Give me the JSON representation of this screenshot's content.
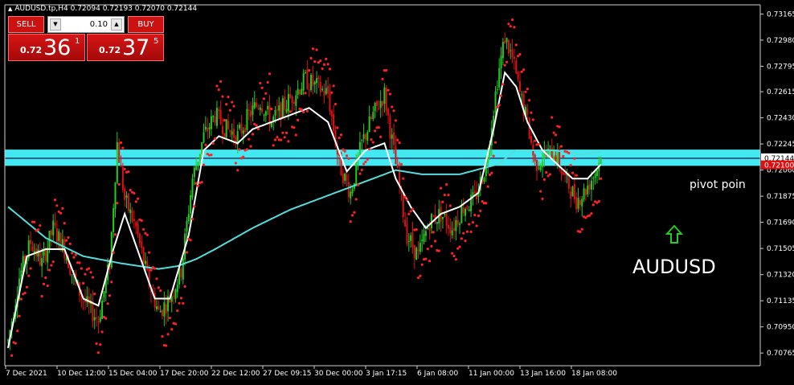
{
  "header": {
    "symbol_line": "AUDUSD.tp,H4  0.72094 0.72193 0.72070 0.72144"
  },
  "trade_panel": {
    "sell_label": "SELL",
    "buy_label": "BUY",
    "lot_value": "0.10",
    "sell_price": {
      "prefix": "0.72",
      "big": "36",
      "sup": "1"
    },
    "buy_price": {
      "prefix": "0.72",
      "big": "37",
      "sup": "5"
    }
  },
  "annotations": {
    "pivot_label": "pivot poin",
    "symbol_label": "AUDUSD"
  },
  "colors": {
    "background": "#000000",
    "bull": "#22cc22",
    "bear": "#dd1111",
    "sar": "#ff2222",
    "ma_fast": "#ffffff",
    "ma_slow": "#55dddd",
    "pivot_zone": "#44e8f0",
    "arrow": "#22cc22"
  },
  "chart_data": {
    "type": "candlestick",
    "symbol": "AUDUSD",
    "timeframe": "H4",
    "ylim": [
      0.70675,
      0.7323
    ],
    "yticks": [
      0.73165,
      0.7298,
      0.72795,
      0.72615,
      0.7243,
      0.72245,
      0.7206,
      0.71875,
      0.7169,
      0.71505,
      0.7132,
      0.71135,
      0.7095,
      0.70765
    ],
    "xticks": [
      "7 Dec 2021",
      "10 Dec 12:00",
      "15 Dec 04:00",
      "17 Dec 20:00",
      "22 Dec 12:00",
      "27 Dec 09:15",
      "30 Dec 00:00",
      "3 Jan 17:15",
      "6 Jan 08:00",
      "11 Jan 00:00",
      "13 Jan 16:00",
      "18 Jan 08:00"
    ],
    "current_price": 0.72144,
    "current_price_label": "0.72144",
    "second_price_label": "0.72100",
    "pivot_zone": [
      0.7209,
      0.72205
    ],
    "pivot_line": 0.72144,
    "anchors": [
      [
        0,
        0.7085
      ],
      [
        6,
        0.713
      ],
      [
        12,
        0.7155
      ],
      [
        18,
        0.714
      ],
      [
        24,
        0.7165
      ],
      [
        30,
        0.715
      ],
      [
        36,
        0.7125
      ],
      [
        42,
        0.711
      ],
      [
        48,
        0.71
      ],
      [
        54,
        0.714
      ],
      [
        58,
        0.7225
      ],
      [
        62,
        0.7185
      ],
      [
        68,
        0.7165
      ],
      [
        74,
        0.713
      ],
      [
        80,
        0.7105
      ],
      [
        86,
        0.7115
      ],
      [
        92,
        0.7135
      ],
      [
        98,
        0.72
      ],
      [
        104,
        0.723
      ],
      [
        110,
        0.7245
      ],
      [
        116,
        0.7235
      ],
      [
        122,
        0.723
      ],
      [
        128,
        0.7245
      ],
      [
        134,
        0.7255
      ],
      [
        140,
        0.724
      ],
      [
        146,
        0.725
      ],
      [
        152,
        0.726
      ],
      [
        158,
        0.727
      ],
      [
        164,
        0.7265
      ],
      [
        170,
        0.726
      ],
      [
        176,
        0.721
      ],
      [
        182,
        0.719
      ],
      [
        188,
        0.7225
      ],
      [
        194,
        0.7245
      ],
      [
        200,
        0.726
      ],
      [
        206,
        0.721
      ],
      [
        212,
        0.716
      ],
      [
        218,
        0.7145
      ],
      [
        224,
        0.717
      ],
      [
        230,
        0.7175
      ],
      [
        236,
        0.7165
      ],
      [
        242,
        0.718
      ],
      [
        248,
        0.7185
      ],
      [
        254,
        0.721
      ],
      [
        260,
        0.727
      ],
      [
        264,
        0.73
      ],
      [
        268,
        0.7285
      ],
      [
        272,
        0.726
      ],
      [
        276,
        0.724
      ],
      [
        280,
        0.721
      ],
      [
        284,
        0.7215
      ],
      [
        290,
        0.722
      ],
      [
        296,
        0.72
      ],
      [
        302,
        0.7185
      ],
      [
        306,
        0.719
      ],
      [
        312,
        0.7205
      ],
      [
        315,
        0.7214
      ]
    ],
    "ma_fast_anchors": [
      [
        0,
        0.708
      ],
      [
        10,
        0.7145
      ],
      [
        20,
        0.715
      ],
      [
        30,
        0.715
      ],
      [
        40,
        0.7115
      ],
      [
        48,
        0.711
      ],
      [
        56,
        0.715
      ],
      [
        62,
        0.7175
      ],
      [
        70,
        0.7145
      ],
      [
        78,
        0.7115
      ],
      [
        86,
        0.7115
      ],
      [
        96,
        0.716
      ],
      [
        104,
        0.722
      ],
      [
        112,
        0.723
      ],
      [
        122,
        0.7225
      ],
      [
        130,
        0.7235
      ],
      [
        140,
        0.724
      ],
      [
        150,
        0.7245
      ],
      [
        160,
        0.725
      ],
      [
        170,
        0.724
      ],
      [
        180,
        0.7205
      ],
      [
        190,
        0.722
      ],
      [
        200,
        0.7225
      ],
      [
        206,
        0.72
      ],
      [
        214,
        0.718
      ],
      [
        222,
        0.7165
      ],
      [
        230,
        0.7175
      ],
      [
        240,
        0.718
      ],
      [
        250,
        0.719
      ],
      [
        258,
        0.7235
      ],
      [
        264,
        0.7275
      ],
      [
        270,
        0.7265
      ],
      [
        276,
        0.724
      ],
      [
        284,
        0.722
      ],
      [
        292,
        0.721
      ],
      [
        300,
        0.72
      ],
      [
        308,
        0.72
      ],
      [
        315,
        0.721
      ]
    ],
    "ma_slow_anchors": [
      [
        0,
        0.718
      ],
      [
        20,
        0.7158
      ],
      [
        40,
        0.7145
      ],
      [
        60,
        0.714
      ],
      [
        80,
        0.7136
      ],
      [
        90,
        0.7138
      ],
      [
        100,
        0.7143
      ],
      [
        110,
        0.715
      ],
      [
        130,
        0.7165
      ],
      [
        150,
        0.7178
      ],
      [
        170,
        0.7188
      ],
      [
        190,
        0.7198
      ],
      [
        206,
        0.7206
      ],
      [
        220,
        0.7203
      ],
      [
        240,
        0.7203
      ],
      [
        260,
        0.721
      ],
      [
        270,
        0.722
      ],
      [
        290,
        0.722
      ],
      [
        305,
        0.7217
      ],
      [
        315,
        0.7219
      ]
    ]
  }
}
